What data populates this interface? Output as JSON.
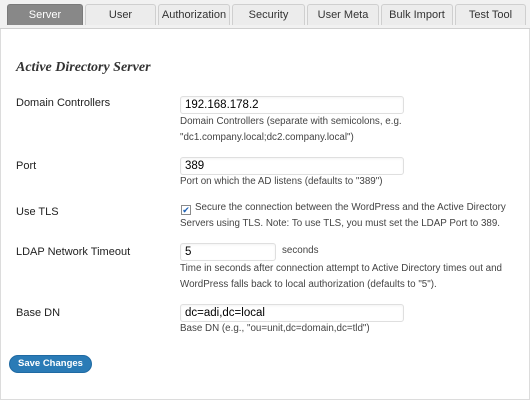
{
  "tabs": [
    {
      "label": "Server",
      "active": true
    },
    {
      "label": "User",
      "active": false
    },
    {
      "label": "Authorization",
      "active": false
    },
    {
      "label": "Security",
      "active": false
    },
    {
      "label": "User Meta",
      "active": false
    },
    {
      "label": "Bulk Import",
      "active": false
    },
    {
      "label": "Test Tool",
      "active": false
    }
  ],
  "section_title": "Active Directory Server",
  "fields": {
    "domain_controllers": {
      "label": "Domain Controllers",
      "value": "192.168.178.2",
      "desc1": "Domain Controllers (separate with semicolons, e.g.",
      "desc2": "\"dc1.company.local;dc2.company.local\")"
    },
    "port": {
      "label": "Port",
      "value": "389",
      "desc": "Port on which the AD listens (defaults to \"389\")"
    },
    "use_tls": {
      "label": "Use TLS",
      "checked": true,
      "desc1": "Secure the connection between the WordPress and the Active Directory",
      "desc2": "Servers using TLS. Note: To use TLS, you must set the LDAP Port to 389."
    },
    "timeout": {
      "label": "LDAP Network Timeout",
      "value": "5",
      "unit": "seconds",
      "desc1": "Time in seconds after connection attempt to Active Directory times out and",
      "desc2": "WordPress falls back to local authorization (defaults to \"5\")."
    },
    "base_dn": {
      "label": "Base DN",
      "value": "dc=adi,dc=local",
      "desc": "Base DN (e.g., \"ou=unit,dc=domain,dc=tld\")"
    }
  },
  "save_button": "Save Changes",
  "colors": {
    "accent": "#2a7bb6",
    "active_tab": "#888888"
  }
}
